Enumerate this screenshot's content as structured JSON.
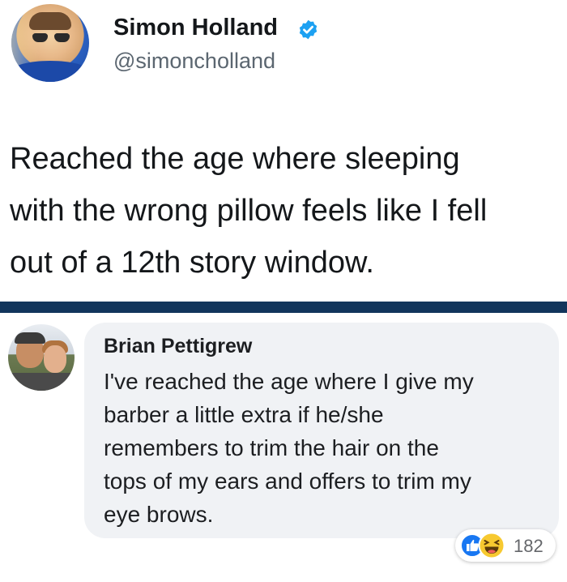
{
  "tweet": {
    "author_name": "Simon Holland",
    "handle": "@simoncholland",
    "text_lines": [
      "Reached the age where sleeping",
      "with the wrong pillow feels like I fell",
      "out of a 12th story window."
    ]
  },
  "comment": {
    "author_name": "Brian Pettigrew",
    "text_lines": [
      "I've reached the age where I give my",
      "barber a little extra if he/she",
      "remembers to trim the hair on the",
      "tops of my ears and offers to trim my",
      "eye brows."
    ],
    "reactions": {
      "icons": [
        "like-icon",
        "haha-icon"
      ],
      "count": "182"
    }
  },
  "colors": {
    "divider": "#12355c",
    "verified_badge": "#1da1f2",
    "comment_bubble": "#f0f2f5",
    "like_blue": "#1877f2",
    "haha_yellow": "#f7c930"
  }
}
